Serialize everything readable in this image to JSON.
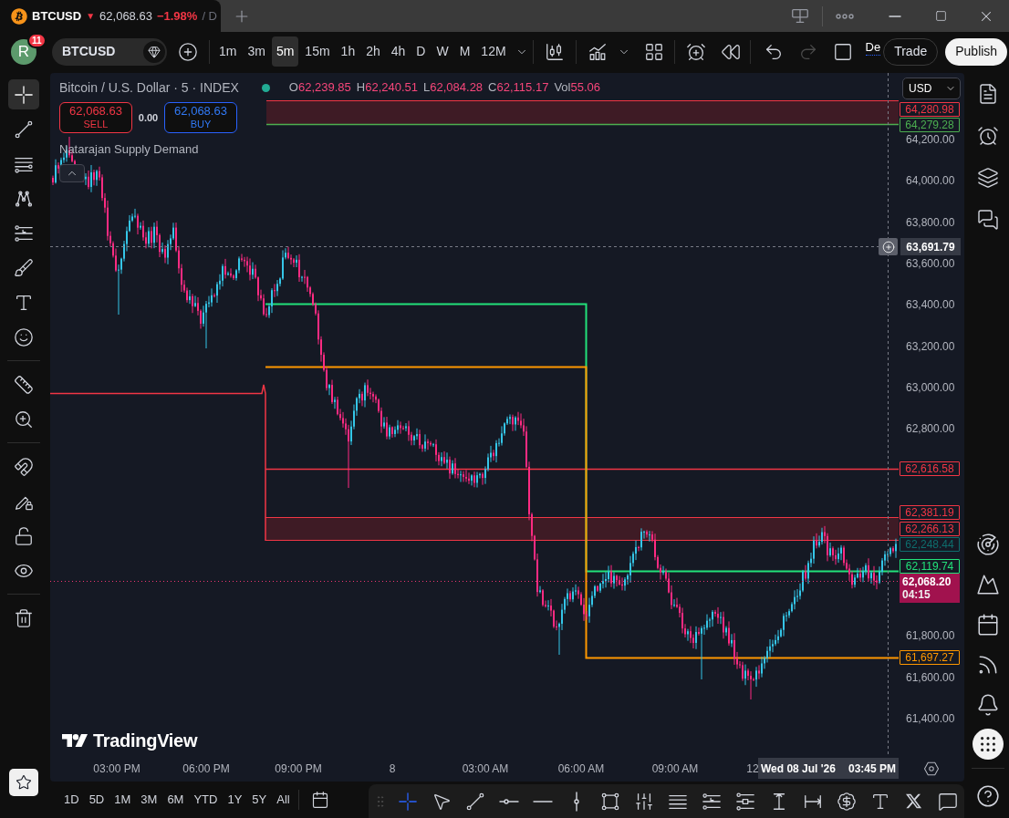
{
  "tab": {
    "symbol": "BTCUSD",
    "direction": "▼",
    "price": "62,068.63",
    "change": "−1.98%",
    "more": "/ D"
  },
  "toolbar": {
    "avatar": "R",
    "badge": "11",
    "symbol": "BTCUSD",
    "intervals": [
      {
        "label": "1m",
        "selected": false
      },
      {
        "label": "3m",
        "selected": false
      },
      {
        "label": "5m",
        "selected": true
      },
      {
        "label": "15m",
        "selected": false
      },
      {
        "label": "1h",
        "selected": false
      },
      {
        "label": "2h",
        "selected": false
      },
      {
        "label": "4h",
        "selected": false
      },
      {
        "label": "D",
        "selected": false
      },
      {
        "label": "W",
        "selected": false
      },
      {
        "label": "M",
        "selected": false
      },
      {
        "label": "12M",
        "selected": false
      }
    ],
    "redo_disabled": true,
    "cut_label": "De",
    "buttons": [
      "Trade",
      "Publish"
    ]
  },
  "left_tools": [
    {
      "selected": true
    },
    {
      "selected": false
    },
    {
      "selected": false
    },
    {
      "selected": false
    },
    {
      "selected": false
    },
    {
      "selected": false
    },
    {
      "selected": false
    },
    {
      "selected": false
    },
    {
      "selected": false
    },
    {
      "selected": false
    },
    {
      "selected": false
    },
    {
      "selected": false
    },
    {
      "selected": false
    },
    {
      "selected": false
    },
    {
      "selected": false
    }
  ],
  "legend": {
    "title": "Bitcoin / U.S. Dollar · 5 · INDEX",
    "ohlc": [
      {
        "key": "O",
        "value": "62,239.85"
      },
      {
        "key": "H",
        "value": "62,240.51"
      },
      {
        "key": "L",
        "value": "62,084.28"
      },
      {
        "key": "C",
        "value": "62,115.17"
      },
      {
        "key": "Vol",
        "value": "55.06"
      }
    ],
    "sell": {
      "price": "62,068.63",
      "label": "SELL"
    },
    "spread": "0.00",
    "buy": {
      "price": "62,068.63",
      "label": "BUY"
    },
    "indicator": "Natarajan Supply Demand"
  },
  "currency": "USD",
  "price_axis": [
    "64,200.00",
    "64,000.00",
    "63,800.00",
    "63,600.00",
    "63,400.00",
    "63,200.00",
    "63,000.00",
    "62,800.00",
    "61,800.00",
    "61,600.00",
    "61,400.00"
  ],
  "price_tags": [
    {
      "price": "64,280.98",
      "color": "#f23645",
      "kind": "outline"
    },
    {
      "price": "64,279.28",
      "color": "#4caf50",
      "kind": "outline"
    },
    {
      "price": "62,616.58",
      "color": "#f23645",
      "kind": "outline"
    },
    {
      "price": "62,381.19",
      "color": "#f23645",
      "kind": "outline"
    },
    {
      "price": "62,266.13",
      "color": "#f23645",
      "kind": "outline"
    },
    {
      "price": "62,248.44",
      "color": "#0e6d6d",
      "kind": "outline"
    },
    {
      "price": "62,119.74",
      "color": "#22e27a",
      "kind": "outline"
    },
    {
      "price": "62,068.20",
      "countdown": "04:15",
      "color": "#a1124e",
      "kind": "filled"
    },
    {
      "price": "61,697.27",
      "color": "#ff9800",
      "kind": "outline"
    }
  ],
  "crosshair": {
    "price": "63,691.79",
    "date": "Wed 08 Jul '26",
    "time": "03:45 PM"
  },
  "time_axis": [
    "03:00 PM",
    "06:00 PM",
    "09:00 PM",
    "8",
    "03:00 AM",
    "06:00 AM",
    "09:00 AM",
    "12"
  ],
  "logo": "TradingView",
  "ranges": [
    "1D",
    "5D",
    "1M",
    "3M",
    "6M",
    "YTD",
    "1Y",
    "5Y",
    "All"
  ],
  "drawing_tools": [
    {
      "selected": true
    },
    {
      "selected": false
    },
    {
      "selected": false
    },
    {
      "selected": false
    },
    {
      "selected": false
    },
    {
      "selected": false
    },
    {
      "selected": false
    },
    {
      "selected": false
    },
    {
      "selected": false
    },
    {
      "selected": false
    },
    {
      "selected": false
    },
    {
      "selected": false
    },
    {
      "selected": false
    },
    {
      "selected": false
    },
    {
      "selected": false
    },
    {
      "selected": false
    },
    {
      "selected": false
    }
  ]
}
